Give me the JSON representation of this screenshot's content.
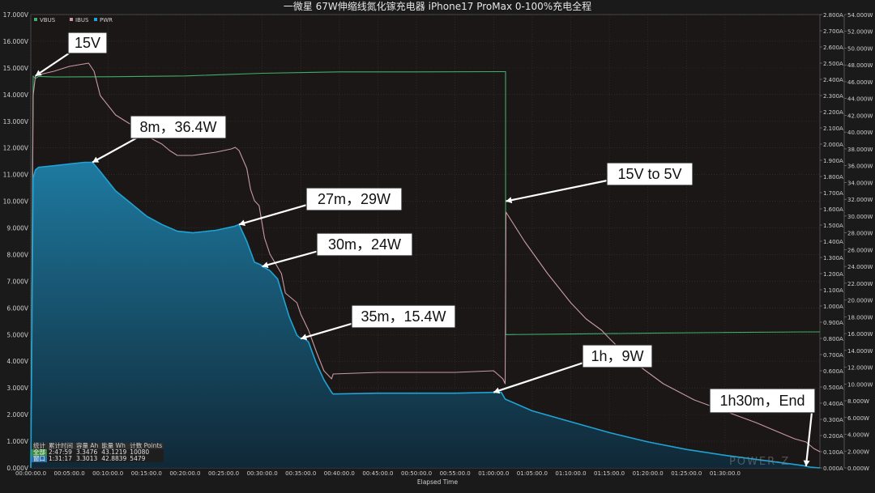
{
  "title": "一微星 67W伸缩线氮化镓充电器 iPhone17 ProMax 0-100%充电全程",
  "xlabel": "Elapsed Time",
  "watermark": "POWER-Z",
  "chart_data": {
    "type": "line",
    "title": "一微星 67W伸缩线氮化镓充电器 iPhone17 ProMax 0-100%充电全程",
    "xlabel": "Elapsed Time",
    "x_unit": "minutes",
    "xlim": [
      0,
      102.3
    ],
    "x_ticks": [
      "00:00:00.0",
      "00:05:00.0",
      "00:10:00.0",
      "00:15:00.0",
      "00:20:00.0",
      "00:25:00.0",
      "00:30:00.0",
      "00:35:00.0",
      "00:40:00.0",
      "00:45:00.0",
      "00:50:00.0",
      "00:55:00.0",
      "01:00:00.0",
      "01:05:00.0",
      "01:10:00.0",
      "01:15:00.0",
      "01:20:00.0",
      "01:25:00.0",
      "01:30:00.0"
    ],
    "axes": {
      "voltage": {
        "lim": [
          0,
          17
        ],
        "ticks": [
          "0.000V",
          "1.000V",
          "2.000V",
          "3.000V",
          "4.000V",
          "5.000V",
          "6.000V",
          "7.000V",
          "8.000V",
          "9.000V",
          "10.000V",
          "11.000V",
          "12.000V",
          "13.000V",
          "14.000V",
          "15.000V",
          "16.000V",
          "17.000V"
        ]
      },
      "current": {
        "lim": [
          0,
          2.8
        ],
        "ticks": [
          "0.000A",
          "0.100A",
          "0.200A",
          "0.300A",
          "0.400A",
          "0.500A",
          "0.600A",
          "0.700A",
          "0.800A",
          "0.900A",
          "1.000A",
          "1.100A",
          "1.200A",
          "1.300A",
          "1.400A",
          "1.500A",
          "1.600A",
          "1.700A",
          "1.800A",
          "1.900A",
          "2.000A",
          "2.100A",
          "2.200A",
          "2.300A",
          "2.400A",
          "2.500A",
          "2.600A",
          "2.700A",
          "2.800A"
        ]
      },
      "power": {
        "lim": [
          0,
          54
        ],
        "ticks": [
          "0.000W",
          "2.000W",
          "4.000W",
          "6.000W",
          "8.000W",
          "10.000W",
          "12.000W",
          "14.000W",
          "16.000W",
          "18.000W",
          "20.000W",
          "22.000W",
          "24.000W",
          "26.000W",
          "28.000W",
          "30.000W",
          "32.000W",
          "34.000W",
          "36.000W",
          "38.000W",
          "40.000W",
          "42.000W",
          "44.000W",
          "46.000W",
          "48.000W",
          "50.000W",
          "52.000W",
          "54.000W"
        ]
      }
    },
    "legend": [
      "VBUS",
      "IBUS",
      "PWR"
    ],
    "legend_position": "top-left",
    "series": [
      {
        "name": "VBUS",
        "axis": "voltage",
        "color": "#3fae6a",
        "x": [
          0,
          0.3,
          0.6,
          1.0,
          3,
          10,
          20,
          30,
          40,
          50,
          61,
          61.55,
          61.56,
          62,
          70,
          80,
          90,
          100.5,
          100.6,
          102.3
        ],
        "y": [
          0,
          14.7,
          14.6,
          14.68,
          14.66,
          14.67,
          14.7,
          14.8,
          14.85,
          14.85,
          14.86,
          14.86,
          5.0,
          5.0,
          5.02,
          5.05,
          5.08,
          5.1,
          5.1,
          5.1
        ]
      },
      {
        "name": "IBUS",
        "axis": "current",
        "color": "#c89aa4",
        "x": [
          0,
          0.3,
          0.6,
          1.2,
          3,
          5,
          7.5,
          8.2,
          9,
          11,
          13,
          15,
          17,
          18,
          19,
          21,
          24,
          26,
          26.5,
          27,
          28,
          28.5,
          29,
          29.6,
          30.3,
          31,
          32.5,
          33,
          34.5,
          35,
          36,
          37,
          38,
          39,
          39.2,
          45,
          55,
          60,
          61.2,
          61.5,
          61.6,
          62,
          64,
          67,
          70,
          72,
          74,
          75,
          78,
          82,
          86,
          90,
          94,
          97,
          99,
          100.5,
          101.5,
          102.3
        ],
        "y": [
          0,
          2.3,
          2.42,
          2.43,
          2.45,
          2.48,
          2.5,
          2.45,
          2.3,
          2.18,
          2.12,
          2.05,
          2.0,
          1.96,
          1.93,
          1.93,
          1.95,
          1.97,
          1.98,
          1.96,
          1.85,
          1.72,
          1.65,
          1.62,
          1.42,
          1.32,
          1.2,
          1.08,
          1.02,
          0.95,
          0.85,
          0.72,
          0.6,
          0.55,
          0.58,
          0.59,
          0.59,
          0.6,
          0.55,
          0.52,
          1.58,
          1.55,
          1.4,
          1.2,
          1.02,
          0.92,
          0.85,
          0.8,
          0.66,
          0.52,
          0.42,
          0.35,
          0.28,
          0.22,
          0.18,
          0.16,
          0.12,
          0.1
        ]
      },
      {
        "name": "PWR",
        "axis": "power",
        "color": "#1fa3d4",
        "x": [
          0,
          0.3,
          0.6,
          1.0,
          3,
          5,
          7,
          8,
          9,
          11,
          13,
          15,
          17,
          19,
          21,
          24,
          26.5,
          27,
          28,
          29,
          29.8,
          30,
          31,
          32,
          32.5,
          33.5,
          34.5,
          35,
          35.5,
          36,
          37,
          38,
          39,
          39.2,
          45,
          55,
          60,
          61,
          61.5,
          65,
          70,
          75,
          80,
          85,
          90,
          95,
          100,
          101,
          102.3
        ],
        "y": [
          0,
          34.5,
          35.5,
          35.8,
          36.0,
          36.2,
          36.4,
          36.4,
          35.3,
          33.0,
          31.5,
          30.0,
          29.0,
          28.2,
          28.0,
          28.3,
          28.8,
          29.0,
          27.0,
          24.5,
          24.2,
          24.0,
          23.5,
          22.5,
          21.0,
          18.0,
          15.8,
          15.4,
          15.4,
          15.0,
          12.5,
          10.5,
          9.0,
          8.8,
          8.9,
          8.9,
          9.0,
          9.0,
          8.2,
          6.8,
          5.5,
          4.2,
          3.1,
          2.2,
          1.5,
          0.9,
          0.3,
          0.1,
          0.0
        ]
      }
    ],
    "annotations": [
      {
        "text": "15V",
        "x": 0.6,
        "y_axis": "voltage",
        "y": 14.7
      },
      {
        "text": "8m，36.4W",
        "x": 8.0,
        "y_axis": "power",
        "y": 36.4
      },
      {
        "text": "27m，29W",
        "x": 27.0,
        "y_axis": "power",
        "y": 29.0
      },
      {
        "text": "30m，24W",
        "x": 30.0,
        "y_axis": "power",
        "y": 24.0
      },
      {
        "text": "35m，15.4W",
        "x": 35.0,
        "y_axis": "power",
        "y": 15.4
      },
      {
        "text": "15V to 5V",
        "x": 61.6,
        "y_axis": "voltage",
        "y": 10.0
      },
      {
        "text": "1h，9W",
        "x": 60.0,
        "y_axis": "power",
        "y": 9.0
      },
      {
        "text": "1h30m，End",
        "x": 100.5,
        "y_axis": "power",
        "y": 0.2
      }
    ]
  },
  "stats": {
    "headers": [
      "统计",
      "累计时间",
      "容量 Ah",
      "能量 Wh",
      "计数 Points"
    ],
    "rows": [
      {
        "label": "全部",
        "time": "2:47:59",
        "ah": "3.3476",
        "wh": "43.1219",
        "points": "10080"
      },
      {
        "label": "窗口",
        "time": "1:31:17",
        "ah": "3.3013",
        "wh": "42.8839",
        "points": "5479"
      }
    ]
  }
}
